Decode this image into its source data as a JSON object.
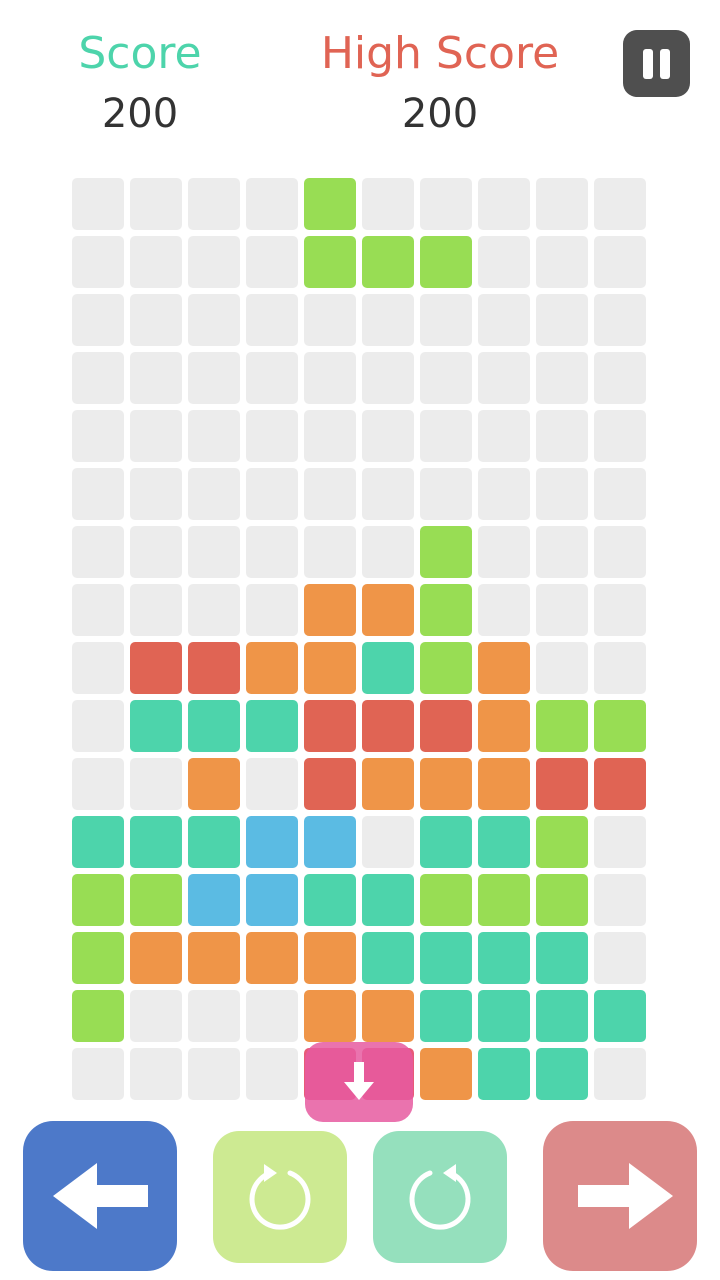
{
  "header": {
    "score_label": "Score",
    "score_value": "200",
    "high_score_label": "High Score",
    "high_score_value": "200",
    "pause_icon": "pause-icon"
  },
  "colors": {
    "score_label": "#4dd4ab",
    "high_score_label": "#e06454",
    "empty": "#ececec",
    "G": "#98dd54",
    "O": "#ef9548",
    "R": "#e06454",
    "T": "#4dd4ab",
    "B": "#5bbbe3",
    "M": "#e85a78",
    "left_button": "#4d79c9",
    "rotate_ccw_button": "#cdea92",
    "rotate_cw_button": "#95e0bd",
    "right_button": "#dc8a8a"
  },
  "board": {
    "columns": 10,
    "rows": 16,
    "grid": [
      "....G.....",
      "....GGG...",
      "..........",
      "..........",
      "..........",
      "..........",
      "......G...",
      "....OOG...",
      ".RROOTGO..",
      ".TTTRRROGG",
      "..O.ROOORR",
      "TTTBB.TTG.",
      "GGBBTTGGG.",
      "GOOOOTTTT.",
      "G...OOTTTT",
      "....MMOTT."
    ]
  },
  "controls": {
    "drop_icon": "arrow-down-icon",
    "move_left_icon": "arrow-left-icon",
    "rotate_left_icon": "rotate-counterclockwise-icon",
    "rotate_right_icon": "rotate-clockwise-icon",
    "move_right_icon": "arrow-right-icon"
  }
}
